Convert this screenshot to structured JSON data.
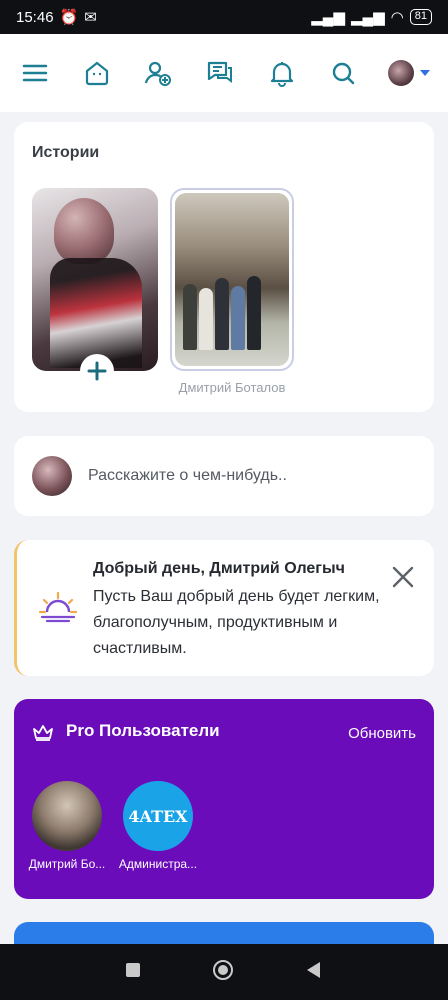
{
  "status_bar": {
    "time": "15:46",
    "battery": "81"
  },
  "stories": {
    "title": "Истории",
    "items": [
      {
        "name": "",
        "is_own": true
      },
      {
        "name": "Дмитрий Боталов",
        "is_own": false
      }
    ]
  },
  "compose": {
    "placeholder": "Расскажите о чем-нибудь.."
  },
  "greeting": {
    "title": "Добрый день, Дмитрий Олегыч",
    "body": "Пусть Ваш добрый день будет легким, благополучным, продуктивным и счастливым."
  },
  "pro_users": {
    "title": "Pro Пользователи",
    "refresh_label": "Обновить",
    "users": [
      {
        "name": "Дмитрий Бо..."
      },
      {
        "name": "Администра...",
        "avatar_text": "4ATEX"
      }
    ]
  },
  "colors": {
    "accent": "#2f6fde",
    "pro_bg": "#6a0cba",
    "greeting_border": "#f1c469"
  }
}
